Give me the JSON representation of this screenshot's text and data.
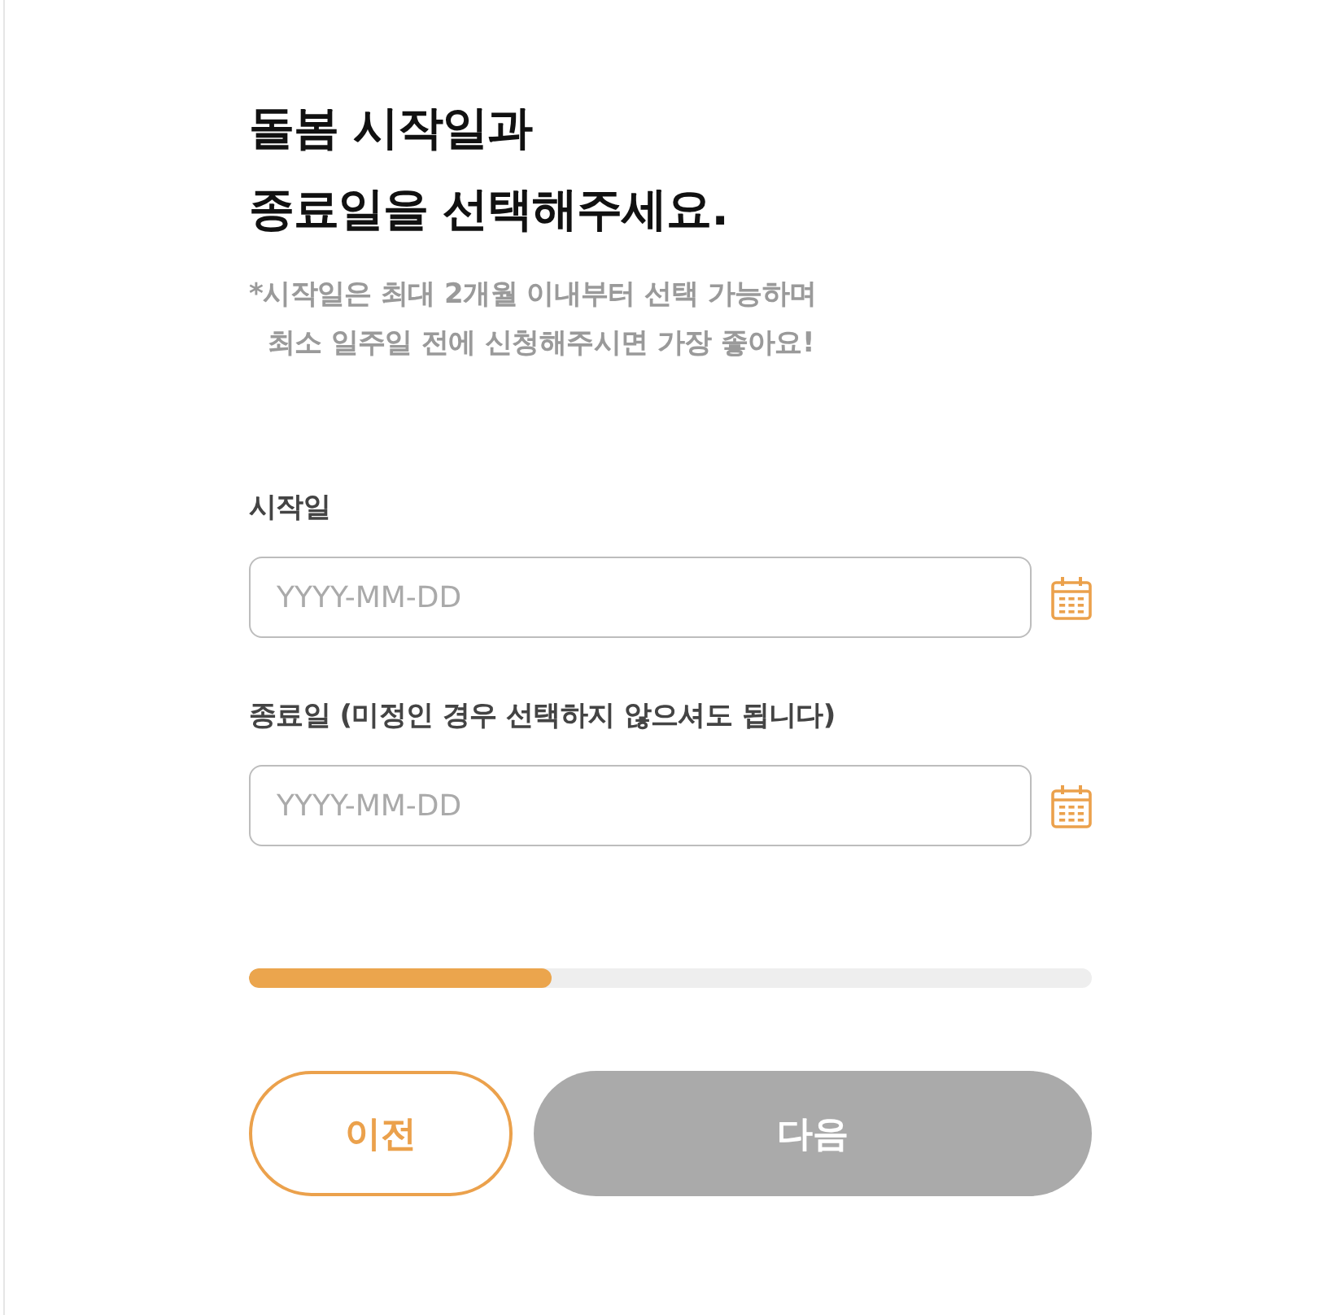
{
  "heading": {
    "title": "돌봄 시작일과\n종료일을 선택해주세요.",
    "note": "*시작일은 최대 2개월 이내부터 선택 가능하며\n  최소 일주일 전에 신청해주시면 가장 좋아요!"
  },
  "fields": [
    {
      "label": "시작일",
      "placeholder": "YYYY-MM-DD"
    },
    {
      "label": "종료일 (미정인 경우 선택하지 않으셔도 됩니다)",
      "placeholder": "YYYY-MM-DD"
    }
  ],
  "progress": {
    "level": 0.36
  },
  "buttons": [
    {
      "label": "이전",
      "kind": "secondary",
      "disabled": false
    },
    {
      "label": "다음",
      "kind": "primary",
      "disabled": true
    }
  ]
}
